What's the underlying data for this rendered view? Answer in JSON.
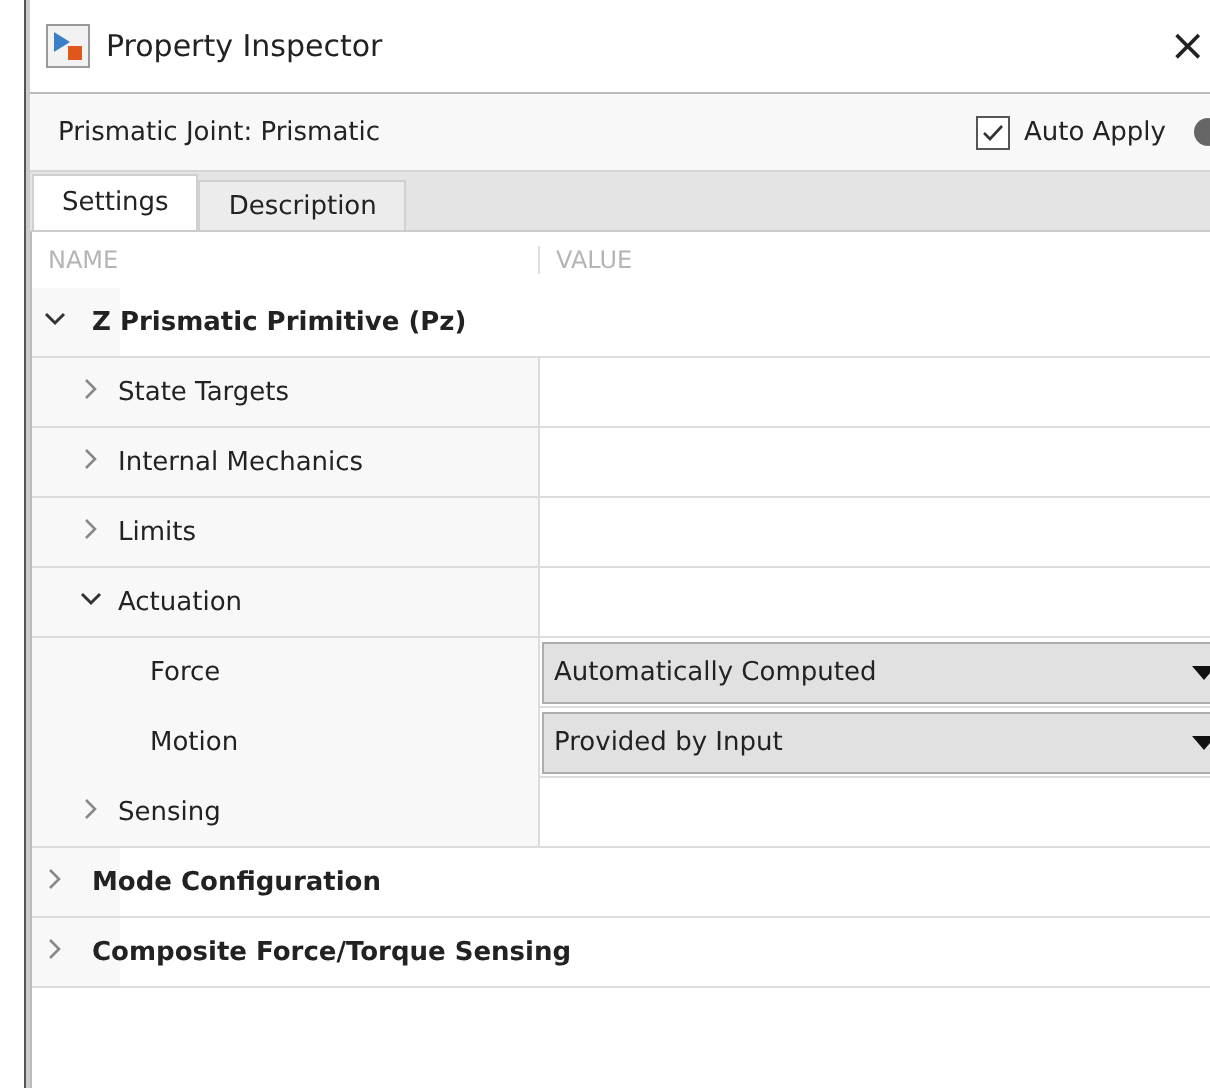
{
  "window": {
    "title": "Property Inspector",
    "close": "×"
  },
  "header": {
    "object": "Prismatic Joint: Prismatic",
    "auto_apply": {
      "label": "Auto Apply",
      "checked": true
    }
  },
  "tabs": [
    {
      "label": "Settings",
      "selected": true
    },
    {
      "label": "Description",
      "selected": false
    }
  ],
  "columns": [
    "NAME",
    "VALUE"
  ],
  "tree": [
    {
      "kind": "section",
      "label": "Z Prismatic Primitive (Pz)",
      "expanded": true,
      "children": [
        {
          "kind": "group",
          "label": "State Targets",
          "expanded": false
        },
        {
          "kind": "group",
          "label": "Internal Mechanics",
          "expanded": false
        },
        {
          "kind": "group",
          "label": "Limits",
          "expanded": false
        },
        {
          "kind": "group",
          "label": "Actuation",
          "expanded": true,
          "children": [
            {
              "kind": "property",
              "label": "Force",
              "value": "Automatically Computed"
            },
            {
              "kind": "property",
              "label": "Motion",
              "value": "Provided by Input"
            }
          ]
        },
        {
          "kind": "group",
          "label": "Sensing",
          "expanded": false
        }
      ]
    },
    {
      "kind": "section",
      "label": "Mode Configuration",
      "expanded": false
    },
    {
      "kind": "section",
      "label": "Composite Force/Torque Sensing",
      "expanded": false
    }
  ]
}
